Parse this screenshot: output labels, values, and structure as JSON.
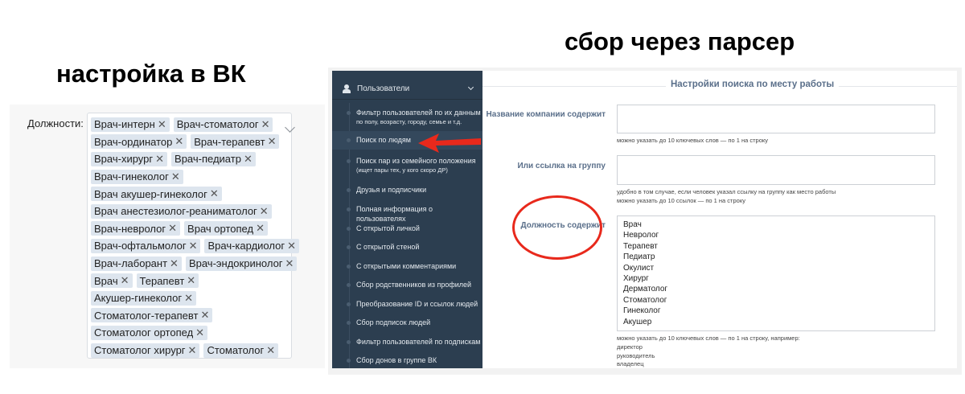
{
  "titles": {
    "left": "настройка в ВК",
    "right": "сбор через парсер"
  },
  "vk": {
    "label": "Должности:",
    "tag_rows": [
      [
        "Врач-интерн",
        "Врач-стоматолог"
      ],
      [
        "Врач-ординатор",
        "Врач-терапевт"
      ],
      [
        "Врач-хирург",
        "Врач-педиатр"
      ],
      [
        "Врач-гинеколог"
      ],
      [
        "Врач акушер-гинеколог"
      ],
      [
        "Врач анестезиолог-реаниматолог"
      ],
      [
        "Врач-невролог",
        "Врач ортопед"
      ],
      [
        "Врач-офтальмолог",
        "Врач-кардиолог"
      ],
      [
        "Врач-лаборант",
        "Врач-эндокринолог"
      ],
      [
        "Врач",
        "Терапевт"
      ],
      [
        "Акушер-гинеколог"
      ],
      [
        "Стоматолог-терапевт"
      ],
      [
        "Стоматолог ортопед"
      ],
      [
        "Стоматолог хирург",
        "Стоматолог"
      ]
    ],
    "remove_glyph": "✕"
  },
  "sidebar": {
    "header": "Пользователи",
    "items": [
      {
        "label": "Фильтр пользователей по их данным",
        "sub": "по полу, возрасту, городу, семье и т.д."
      },
      {
        "label": "Поиск по людям",
        "active": true
      },
      {
        "label": "Поиск пар из семейного положения",
        "sub": "(ищет пары тех, у кого скоро ДР)"
      },
      {
        "label": "Друзья и подписчики"
      },
      {
        "label": "Полная информация о пользователях"
      },
      {
        "label": "С открытой личкой"
      },
      {
        "label": "С открытой стеной"
      },
      {
        "label": "С открытыми комментариями"
      },
      {
        "label": "Сбор родственников из профилей"
      },
      {
        "label": "Преобразование ID и ссылок людей"
      },
      {
        "label": "Сбор подписок людей"
      },
      {
        "label": "Фильтр пользователей по подпискам"
      },
      {
        "label": "Сбор донов в группе ВК"
      }
    ]
  },
  "form": {
    "section_title": "Настройки поиска по месту работы",
    "company_label": "Название компании содержит",
    "company_value": "",
    "company_hint": "можно указать до 10 ключевых слов — по 1 на строку",
    "group_label": "Или ссылка на группу",
    "group_value": "",
    "group_hint1": "удобно в том случае, если человек указал ссылку на группу как место работы",
    "group_hint2": "можно указать до 10 ссылок — по 1 на строку",
    "position_label": "Должность содержит",
    "position_lines": [
      "Врач",
      "Невролог",
      "Терапевт",
      "Педиатр",
      "Окулист",
      "Хирург",
      "Дерматолог",
      "Стоматолог",
      "Гинеколог",
      "Акушер"
    ],
    "position_hint": "можно указать до 10 ключевых слов — по 1 на строку, например:",
    "examples": [
      "директор",
      "руководитель",
      "владелец"
    ]
  },
  "colors": {
    "sidebar": "#2c3e50",
    "annotation": "#e8291c",
    "label": "#5a6f8a"
  }
}
